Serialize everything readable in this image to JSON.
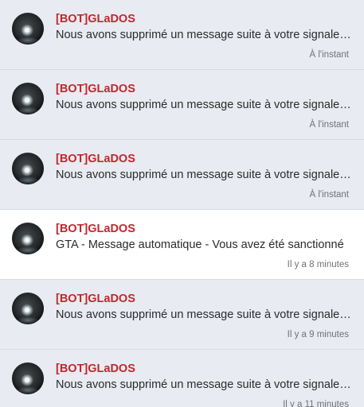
{
  "colors": {
    "unread_bg": "#e8ebf1",
    "read_bg": "#ffffff",
    "sender": "#c0282d",
    "message": "#2b2b2b",
    "time": "#6f7276"
  },
  "notifications": [
    {
      "sender": "[BOT]GLaDOS",
      "message": "Nous avons supprimé un message suite à votre signalement",
      "time": "À l'instant",
      "avatar_icon": "glados-avatar",
      "read": false
    },
    {
      "sender": "[BOT]GLaDOS",
      "message": "Nous avons supprimé un message suite à votre signalement",
      "time": "À l'instant",
      "avatar_icon": "glados-avatar",
      "read": false
    },
    {
      "sender": "[BOT]GLaDOS",
      "message": "Nous avons supprimé un message suite à votre signalement",
      "time": "À l'instant",
      "avatar_icon": "glados-avatar",
      "read": false
    },
    {
      "sender": "[BOT]GLaDOS",
      "message": "GTA - Message automatique - Vous avez été sanctionné",
      "time": "Il y a 8 minutes",
      "avatar_icon": "glados-avatar",
      "read": true
    },
    {
      "sender": "[BOT]GLaDOS",
      "message": "Nous avons supprimé un message suite à votre signalement",
      "time": "Il y a 9 minutes",
      "avatar_icon": "glados-avatar",
      "read": false
    },
    {
      "sender": "[BOT]GLaDOS",
      "message": "Nous avons supprimé un message suite à votre signalement",
      "time": "Il y a 11 minutes",
      "avatar_icon": "glados-avatar",
      "read": false
    }
  ]
}
